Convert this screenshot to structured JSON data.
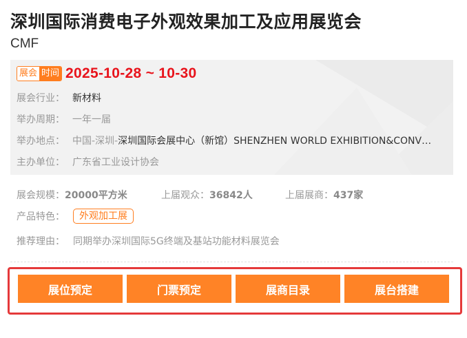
{
  "expo": {
    "title": "深圳国际消费电子外观效果加工及应用展览会",
    "subtitle": "CMF"
  },
  "info": {
    "tag_left": "展会",
    "tag_right": "时间",
    "date": "2025-10-28 ~ 10-30",
    "industry_label": "展会行业：",
    "industry": "新材料",
    "cycle_label": "举办周期：",
    "cycle": "一年一届",
    "location_label": "举办地点：",
    "location_prefix": "中国-深圳-",
    "location": "深圳国际会展中心（新馆）SHENZHEN WORLD EXHIBITION&CONVENTION CENTER",
    "organizer_label": "主办单位：",
    "organizer": "广东省工业设计协会"
  },
  "stats": {
    "scale_label": "展会规模：",
    "scale": "20000平方米",
    "visitors_label": "上届观众：",
    "visitors": "36842人",
    "exhibitors_label": "上届展商：",
    "exhibitors": "437家"
  },
  "feature": {
    "label": "产品特色：",
    "chip": "外观加工展"
  },
  "reason": {
    "label": "推荐理由：",
    "text": "同期举办深圳国际5G终端及基站功能材料展览会"
  },
  "actions": {
    "booth": "展位预定",
    "ticket": "门票预定",
    "catalog": "展商目录",
    "build": "展台搭建"
  },
  "colors": {
    "accent": "#ff8326",
    "date_red": "#e8141c",
    "frame_red": "#e5393a"
  }
}
